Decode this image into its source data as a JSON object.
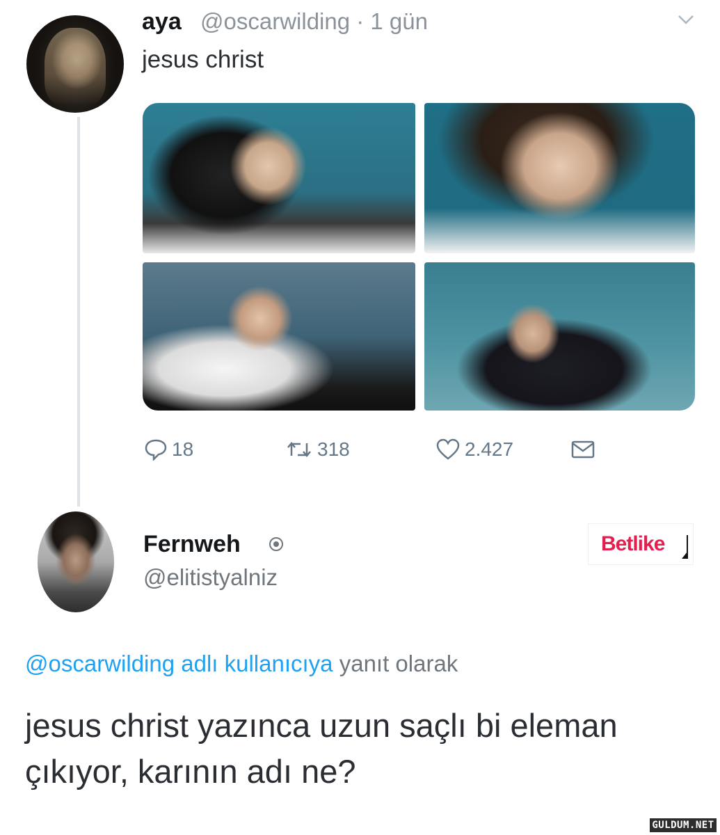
{
  "tweet": {
    "author_name": "aya",
    "author_handle_time": "@oscarwilding · 1 gün",
    "text": "jesus christ",
    "avatar_icon": "profile-photo",
    "menu_icon": "chevron-down-icon",
    "media": [
      {
        "name": "curling-player-photo-1"
      },
      {
        "name": "curling-player-photo-2"
      },
      {
        "name": "curling-player-photo-3"
      },
      {
        "name": "curling-player-photo-4"
      }
    ],
    "actions": {
      "reply_count": "18",
      "retweet_count": "318",
      "like_count": "2.427",
      "reply_icon": "comment-icon",
      "retweet_icon": "retweet-icon",
      "like_icon": "heart-icon",
      "dm_icon": "envelope-icon"
    }
  },
  "reply": {
    "author_name": "Fernweh",
    "author_handle": "@elitistyalniz",
    "badge_icon": "verified-icon",
    "in_reply_to_link": "@oscarwilding adlı kullanıcıya",
    "in_reply_to_suffix": " yanıt olarak",
    "text": "jesus christ yazınca uzun saçlı bi eleman çıkıyor, karının adı ne?"
  },
  "ad": {
    "brand": "Betlike"
  },
  "watermark": "GULDUM.NET",
  "colors": {
    "link": "#1da1f2",
    "muted": "#657786",
    "brand": "#e41e4e"
  }
}
